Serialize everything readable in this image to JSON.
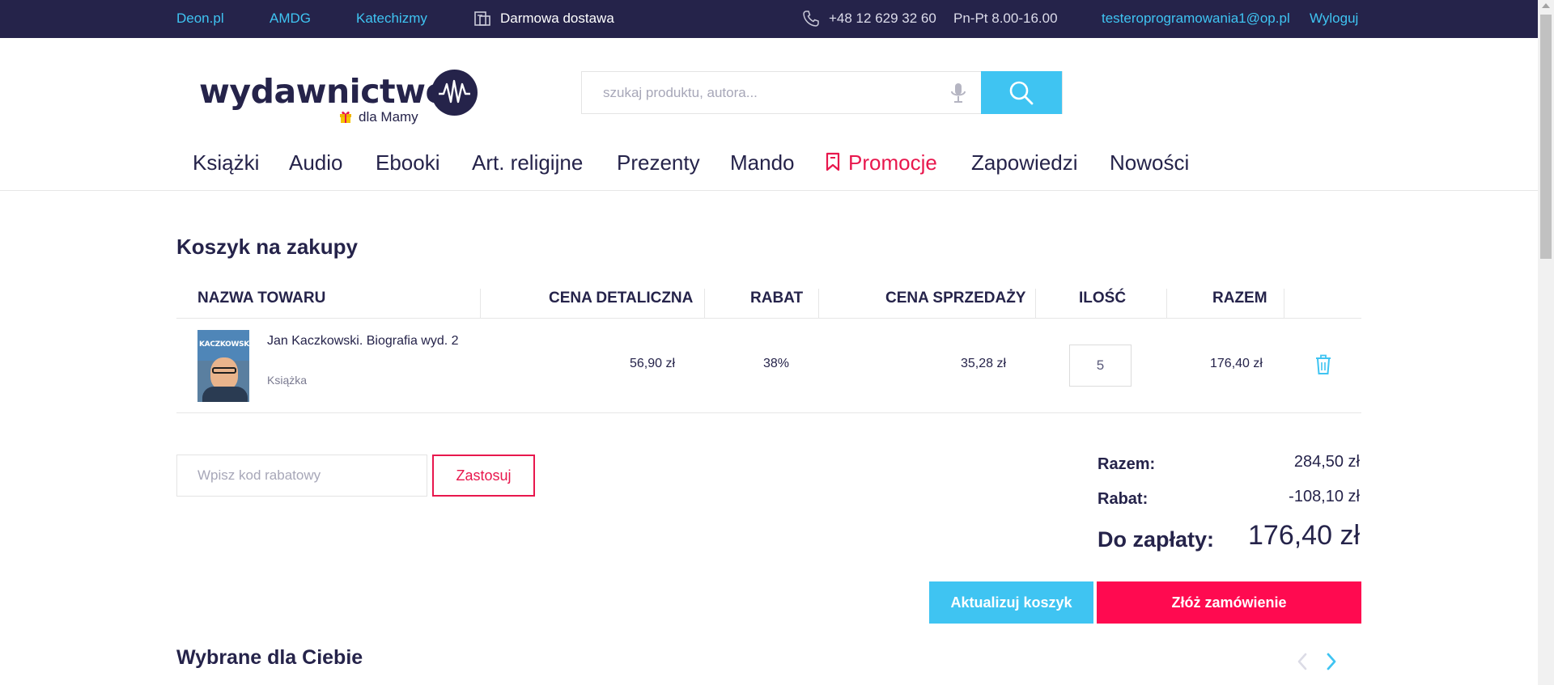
{
  "topbar": {
    "links": [
      "Deon.pl",
      "AMDG",
      "Katechizmy"
    ],
    "delivery": "Darmowa dostawa",
    "phone": "+48 12 629 32 60",
    "hours": "Pn-Pt 8.00-16.00",
    "email": "testeroprogramowania1@op.pl",
    "logout": "Wyloguj"
  },
  "logo": {
    "word": "wydawnictwo",
    "subtitle": "dla Mamy"
  },
  "search": {
    "placeholder": "szukaj produktu, autora..."
  },
  "nav": {
    "items": [
      "Książki",
      "Audio",
      "Ebooki",
      "Art. religijne",
      "Prezenty",
      "Mando",
      "Promocje",
      "Zapowiedzi",
      "Nowości"
    ]
  },
  "cart": {
    "title": "Koszyk na zakupy",
    "columns": [
      "NAZWA TOWARU",
      "CENA DETALICZNA",
      "RABAT",
      "CENA SPRZEDAŻY",
      "ILOŚĆ",
      "RAZEM"
    ],
    "items": [
      {
        "cover_text": "KACZKOWSKI",
        "name": "Jan Kaczkowski. Biografia wyd. 2",
        "type": "Książka",
        "retail_price": "56,90 zł",
        "discount": "38%",
        "sale_price": "35,28 zł",
        "quantity": "5",
        "total": "176,40 zł"
      }
    ],
    "coupon_placeholder": "Wpisz kod rabatowy",
    "apply_label": "Zastosuj",
    "summary": {
      "subtotal_label": "Razem:",
      "subtotal": "284,50 zł",
      "discount_label": "Rabat:",
      "discount": "-108,10 zł",
      "due_label": "Do zapłaty:",
      "due": "176,40 zł"
    },
    "update_label": "Aktualizuj koszyk",
    "order_label": "Złóż zamówienie"
  },
  "recommendations": {
    "title": "Wybrane dla Ciebie"
  },
  "colors": {
    "navy": "#25234a",
    "accent_blue": "#3fc4f2",
    "accent_red": "#ff0a50"
  },
  "icons": [
    "phone-icon",
    "delivery-icon",
    "gift-icon",
    "microphone-icon",
    "search-icon",
    "bookmark-icon",
    "trash-icon",
    "chevron-left-icon",
    "chevron-right-icon"
  ]
}
